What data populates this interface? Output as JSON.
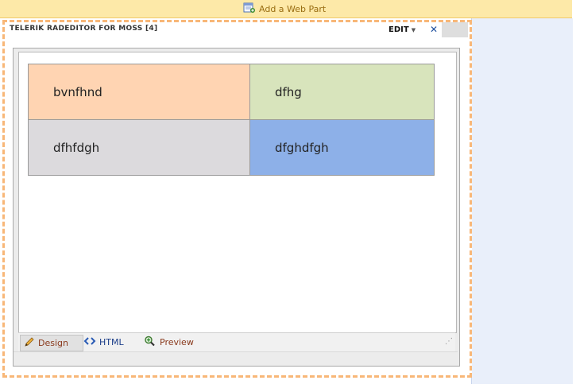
{
  "toolbar": {
    "add_web_part_label": "Add a Web Part"
  },
  "webpart": {
    "title": "TELERIK RADEDITOR FOR MOSS [4]",
    "edit_label": "EDIT",
    "close_glyph": "✕"
  },
  "editor": {
    "table": {
      "rows": [
        [
          {
            "text": "bvnfhnd",
            "bg": "#ffd4b2"
          },
          {
            "text": "dfhg",
            "bg": "#d8e4bc"
          }
        ],
        [
          {
            "text": "dfhfdgh",
            "bg": "#dcdadd"
          },
          {
            "text": "dfghdfgh",
            "bg": "#8db0e8"
          }
        ]
      ]
    },
    "modes": {
      "design": "Design",
      "html": "HTML",
      "preview": "Preview"
    }
  },
  "colors": {
    "zone_border": "#f8b778",
    "add_bar": "#fde9a8",
    "right_panel": "#e9effa"
  },
  "icons": {
    "add_web_part": "add-web-part-icon",
    "design": "pencil-icon",
    "html": "code-brackets-icon",
    "preview": "magnifier-plus-icon"
  }
}
